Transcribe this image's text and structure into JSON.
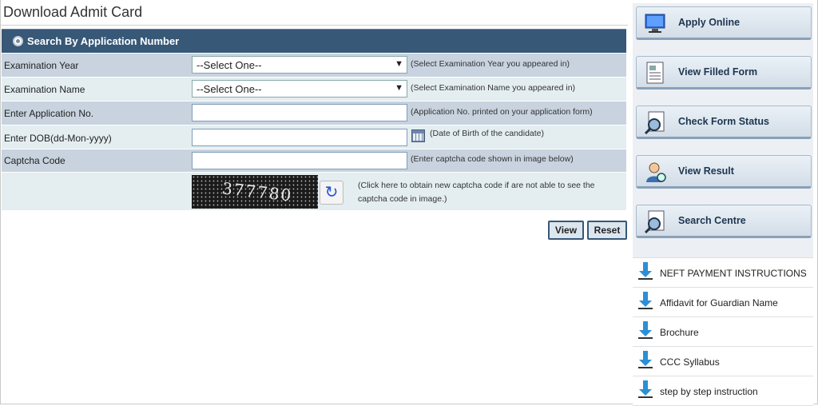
{
  "page_title": "Download Admit Card",
  "section_title": "Search By Application Number",
  "fields": {
    "exam_year": {
      "label": "Examination Year",
      "value": "--Select One--",
      "hint": "(Select Examination Year you appeared in)"
    },
    "exam_name": {
      "label": "Examination Name",
      "value": "--Select One--",
      "hint": "(Select Examination Name you appeared in)"
    },
    "app_no": {
      "label": "Enter Application No.",
      "value": "",
      "hint": "(Application No. printed on your application form)"
    },
    "dob": {
      "label": "Enter DOB(dd-Mon-yyyy)",
      "value": "",
      "hint": "(Date of Birth of the candidate)"
    },
    "captcha": {
      "label": "Captcha Code",
      "value": "",
      "hint": "(Enter captcha code shown in image below)"
    }
  },
  "captcha_image_text": "377780",
  "captcha_refresh_hint_line1": "(Click here to obtain new captcha code if are not able to see the",
  "captcha_refresh_hint_line2": "captcha code in image.)",
  "buttons": {
    "view": "View",
    "reset": "Reset"
  },
  "sidebar": {
    "buttons": [
      {
        "label": "Apply Online",
        "icon": "monitor-icon"
      },
      {
        "label": "View Filled Form",
        "icon": "form-icon"
      },
      {
        "label": "Check Form Status",
        "icon": "magnifier-doc-icon"
      },
      {
        "label": "View Result",
        "icon": "user-icon"
      },
      {
        "label": "Search Centre",
        "icon": "magnifier-doc-icon"
      }
    ],
    "links": [
      {
        "label": "NEFT PAYMENT INSTRUCTIONS"
      },
      {
        "label": "Affidavit for Guardian Name"
      },
      {
        "label": "Brochure"
      },
      {
        "label": "CCC Syllabus"
      },
      {
        "label": "step by step instruction"
      }
    ]
  },
  "colors": {
    "header_bg": "#375877",
    "row_alt_a": "#c8d3df",
    "row_alt_b": "#e4eef0"
  }
}
